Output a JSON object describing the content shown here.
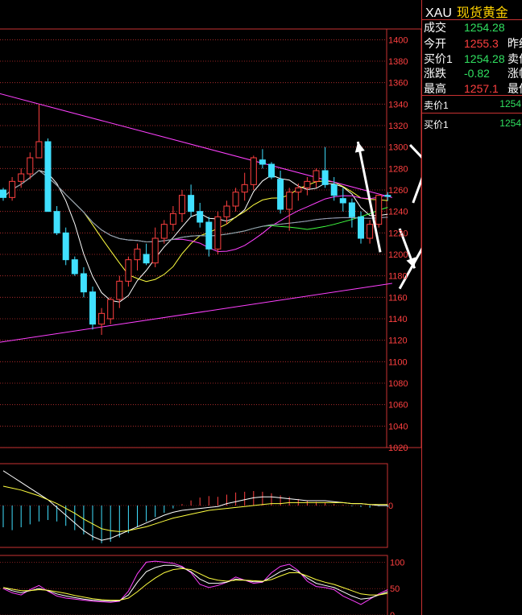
{
  "quote": {
    "symbol": "XAU",
    "name": "现货黄金",
    "rows": [
      {
        "label": "成交",
        "value": "1254.28",
        "tone": "dn",
        "extra": ""
      },
      {
        "label": "今开",
        "value": "1255.3",
        "tone": "up",
        "extra": "昨结"
      },
      {
        "label": "买价1",
        "value": "1254.28",
        "tone": "dn",
        "extra": "卖价"
      },
      {
        "label": "涨跌",
        "value": "-0.82",
        "tone": "dn",
        "extra": "涨幅"
      },
      {
        "label": "最高",
        "value": "1257.1",
        "tone": "up",
        "extra": "最低"
      }
    ],
    "orders": [
      {
        "label": "卖价1",
        "value": "1254"
      },
      {
        "label": "买价1",
        "value": "1254"
      }
    ]
  },
  "colors": {
    "up": "#ff4040",
    "down": "#40e0ff",
    "grid": "#c83232",
    "axis": "#ff4040"
  },
  "chart_data": [
    {
      "type": "candlestick",
      "y_ticks": [
        "1400",
        "1380",
        "1360",
        "1340",
        "1320",
        "1300",
        "1280",
        "1260",
        "1240",
        "1220",
        "1200",
        "1180",
        "1160",
        "1140",
        "1120",
        "1100",
        "1080",
        "1060",
        "1040",
        "1020"
      ],
      "ylim": [
        1020,
        1410
      ],
      "ohlc": [
        [
          1260,
          1262,
          1250,
          1253
        ],
        [
          1253,
          1272,
          1250,
          1268
        ],
        [
          1268,
          1280,
          1262,
          1275
        ],
        [
          1275,
          1295,
          1270,
          1290
        ],
        [
          1290,
          1340,
          1295,
          1305
        ],
        [
          1305,
          1308,
          1258,
          1240
        ],
        [
          1240,
          1245,
          1218,
          1220
        ],
        [
          1220,
          1225,
          1190,
          1195
        ],
        [
          1195,
          1198,
          1180,
          1182
        ],
        [
          1182,
          1188,
          1160,
          1165
        ],
        [
          1165,
          1170,
          1130,
          1135
        ],
        [
          1135,
          1150,
          1125,
          1145
        ],
        [
          1140,
          1160,
          1135,
          1158
        ],
        [
          1158,
          1180,
          1150,
          1175
        ],
        [
          1175,
          1198,
          1170,
          1195
        ],
        [
          1195,
          1210,
          1185,
          1205
        ],
        [
          1200,
          1210,
          1190,
          1192
        ],
        [
          1192,
          1225,
          1188,
          1215
        ],
        [
          1215,
          1232,
          1210,
          1228
        ],
        [
          1228,
          1245,
          1222,
          1238
        ],
        [
          1238,
          1260,
          1230,
          1255
        ],
        [
          1255,
          1265,
          1235,
          1240
        ],
        [
          1240,
          1248,
          1225,
          1230
        ],
        [
          1230,
          1235,
          1198,
          1205
        ],
        [
          1205,
          1240,
          1200,
          1235
        ],
        [
          1235,
          1250,
          1228,
          1245
        ],
        [
          1245,
          1262,
          1240,
          1258
        ],
        [
          1258,
          1276,
          1250,
          1265
        ],
        [
          1265,
          1292,
          1260,
          1290
        ],
        [
          1288,
          1298,
          1280,
          1284
        ],
        [
          1284,
          1286,
          1270,
          1272
        ],
        [
          1270,
          1278,
          1238,
          1242
        ],
        [
          1242,
          1262,
          1222,
          1258
        ],
        [
          1258,
          1266,
          1250,
          1262
        ],
        [
          1262,
          1272,
          1255,
          1268
        ],
        [
          1268,
          1280,
          1262,
          1278
        ],
        [
          1278,
          1300,
          1262,
          1265
        ],
        [
          1265,
          1272,
          1250,
          1255
        ],
        [
          1252,
          1262,
          1240,
          1248
        ],
        [
          1248,
          1252,
          1225,
          1235
        ],
        [
          1235,
          1240,
          1210,
          1215
        ],
        [
          1215,
          1232,
          1210,
          1228
        ],
        [
          1228,
          1250,
          1225,
          1255
        ],
        [
          1255,
          1258,
          1250,
          1254
        ]
      ],
      "indicators": [
        {
          "color": "#ffffff",
          "period": 5
        },
        {
          "color": "#ffff40",
          "period": 10
        },
        {
          "color": "#ff40ff",
          "period": 20
        },
        {
          "color": "#40ff40",
          "period": 30
        },
        {
          "color": "#3c6cff",
          "period": 60
        },
        {
          "color": "#a0a0a0",
          "period": 120
        }
      ],
      "trendlines": [
        {
          "from": [
            -0.5,
            1350
          ],
          "to": [
            43.5,
            1253
          ],
          "color": "#ff40ff"
        },
        {
          "from": [
            -0.5,
            1118
          ],
          "to": [
            43.5,
            1173
          ],
          "color": "#ff40ff"
        }
      ],
      "arrows": [
        {
          "from": [
            1273,
            1302
          ],
          "to": [
            1318,
            1236
          ],
          "color": "#ffffff"
        },
        {
          "from": [
            1318,
            1238
          ],
          "to": [
            1337,
            1144
          ],
          "color": "#ffffff"
        },
        {
          "from": [
            1266,
            1224
          ],
          "to": [
            1276,
            1187
          ],
          "color": "#ffffff"
        },
        {
          "from": [
            1266,
            1168
          ],
          "to": [
            1295,
            1240
          ],
          "color": "#ffffff"
        },
        {
          "from": [
            1253,
            1202
          ],
          "to": [
            1238,
            1305
          ],
          "color": "#ffffff"
        },
        {
          "from": [
            1275,
            1248
          ],
          "to": [
            1288,
            1297
          ],
          "color": "#ffffff"
        }
      ]
    },
    {
      "type": "bar",
      "y_ticks": [
        "0"
      ],
      "macd": [
        -30,
        -34,
        -30,
        -26,
        -22,
        -20,
        -22,
        -28,
        -34,
        -40,
        -48,
        -52,
        -50,
        -44,
        -38,
        -30,
        -22,
        -16,
        -10,
        -4,
        2,
        7,
        11,
        13,
        12,
        15,
        18,
        19,
        20,
        19,
        17,
        14,
        12,
        9,
        7,
        5,
        4,
        2,
        1,
        -1,
        -2,
        -3,
        -1,
        -2
      ],
      "dif": [
        36,
        30,
        24,
        18,
        12,
        6,
        -2,
        -10,
        -18,
        -26,
        -32,
        -36,
        -34,
        -30,
        -26,
        -22,
        -18,
        -14,
        -10,
        -7,
        -5,
        -4,
        -3,
        -2,
        -1,
        2,
        4,
        6,
        8,
        9,
        9,
        8,
        7,
        6,
        5,
        5,
        5,
        4,
        3,
        2,
        2,
        1,
        0,
        0
      ],
      "dea": [
        20,
        18,
        16,
        13,
        10,
        6,
        2,
        -3,
        -8,
        -14,
        -19,
        -24,
        -26,
        -27,
        -26,
        -24,
        -22,
        -19,
        -16,
        -13,
        -11,
        -9,
        -7,
        -5,
        -4,
        -3,
        -2,
        -1,
        0,
        1,
        2,
        2,
        3,
        3,
        3,
        3,
        3,
        3,
        3,
        2,
        2,
        1,
        1,
        1
      ]
    },
    {
      "type": "line",
      "y_ticks": [
        "100",
        "50",
        "0"
      ],
      "ylim": [
        0,
        125
      ],
      "series": [
        {
          "color": "#ff40ff",
          "values": [
            50,
            42,
            38,
            48,
            56,
            45,
            36,
            32,
            30,
            28,
            26,
            25,
            24,
            26,
            45,
            78,
            100,
            102,
            100,
            98,
            92,
            80,
            58,
            52,
            56,
            62,
            72,
            66,
            60,
            62,
            80,
            92,
            96,
            84,
            64,
            54,
            52,
            48,
            36,
            28,
            20,
            30,
            40,
            48
          ]
        },
        {
          "color": "#ffffff",
          "values": [
            52,
            46,
            42,
            46,
            50,
            46,
            40,
            36,
            33,
            30,
            28,
            27,
            26,
            27,
            38,
            62,
            82,
            90,
            94,
            94,
            90,
            82,
            68,
            60,
            60,
            62,
            68,
            66,
            63,
            63,
            72,
            82,
            88,
            82,
            70,
            60,
            56,
            52,
            44,
            36,
            30,
            32,
            38,
            44
          ]
        },
        {
          "color": "#ffff40",
          "values": [
            52,
            49,
            46,
            46,
            48,
            47,
            44,
            41,
            37,
            34,
            31,
            29,
            28,
            28,
            32,
            44,
            58,
            70,
            80,
            86,
            88,
            86,
            78,
            70,
            66,
            64,
            66,
            66,
            65,
            64,
            67,
            74,
            80,
            80,
            74,
            67,
            62,
            58,
            52,
            46,
            40,
            38,
            38,
            41
          ]
        }
      ]
    }
  ]
}
